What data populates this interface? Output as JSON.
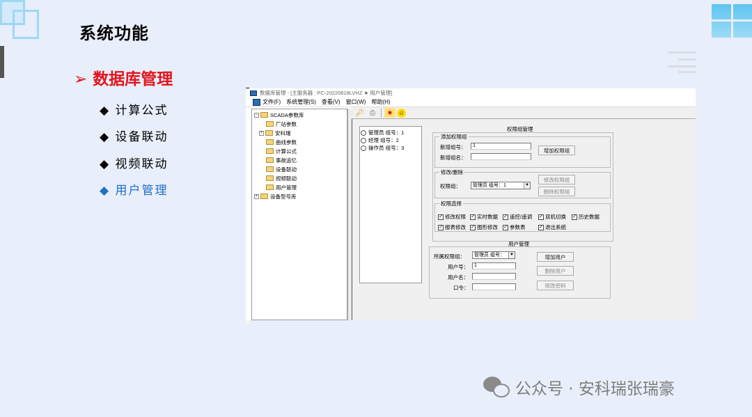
{
  "slide": {
    "title": "系统功能",
    "section_title": "➢ 数据库管理",
    "menu": [
      {
        "label": "◆ 计算公式",
        "active": false
      },
      {
        "label": "◆ 设备联动",
        "active": false
      },
      {
        "label": "◆ 视频联动",
        "active": false
      },
      {
        "label": "◆ 用户管理",
        "active": true
      }
    ],
    "watermark": "公众号 · 安科瑞张瑞豪"
  },
  "window": {
    "title": "数据库管理 - [主服务器 : PC-20220818LVHZ ★ 用户管理]",
    "menubar": [
      "文件(F)",
      "系统管理(S)",
      "查看(V)",
      "窗口(W)",
      "帮助(H)"
    ],
    "toolbar_icons": [
      "key-icon",
      "printer-icon",
      "star-icon",
      "smiley-icon"
    ],
    "tree": {
      "root": "SCADA参数库",
      "children": [
        "厂站参数",
        "安科瑞",
        "曲线参数",
        "计算公式",
        "事故追忆",
        "设备联动",
        "视频联动",
        "用户管理"
      ],
      "second_root": "设备型号库"
    },
    "groups_list": [
      "管理员  组号：1",
      "经理  组号：2",
      "操作员  组号：3"
    ],
    "perm_group_mgmt": {
      "title": "权限组管理",
      "add": {
        "legend": "添加权限组",
        "new_group_no_label": "新增组号：",
        "new_group_no_value": "1",
        "new_group_name_label": "新增组名：",
        "new_group_name_value": "",
        "add_button": "增加权限组"
      },
      "edit": {
        "legend": "修改/删除",
        "group_label": "权限组：",
        "group_value": "管理员  组号：1",
        "modify_button": "修改权限组",
        "delete_button": "删除权限组"
      },
      "perm_select": {
        "legend": "权限选择",
        "items": [
          {
            "label": "修改权限",
            "checked": true
          },
          {
            "label": "实时数据",
            "checked": true
          },
          {
            "label": "遥控/遥调",
            "checked": true
          },
          {
            "label": "双机切换",
            "checked": true
          },
          {
            "label": "历史数据",
            "checked": true
          },
          {
            "label": "报表修改",
            "checked": true
          },
          {
            "label": "图形修改",
            "checked": true
          },
          {
            "label": "参数表",
            "checked": true
          },
          {
            "label": "退出系统",
            "checked": true
          }
        ]
      }
    },
    "user_mgmt": {
      "title": "用户管理",
      "group_label": "所属权限组：",
      "group_value": "管理员  组号：",
      "user_no_label": "用户号：",
      "user_no_value": "1",
      "user_name_label": "用户名：",
      "user_name_value": "",
      "password_label": "口令：",
      "password_value": "",
      "add_user_button": "增加用户",
      "delete_user_button": "删除用户",
      "change_password_button": "修改密码"
    }
  }
}
